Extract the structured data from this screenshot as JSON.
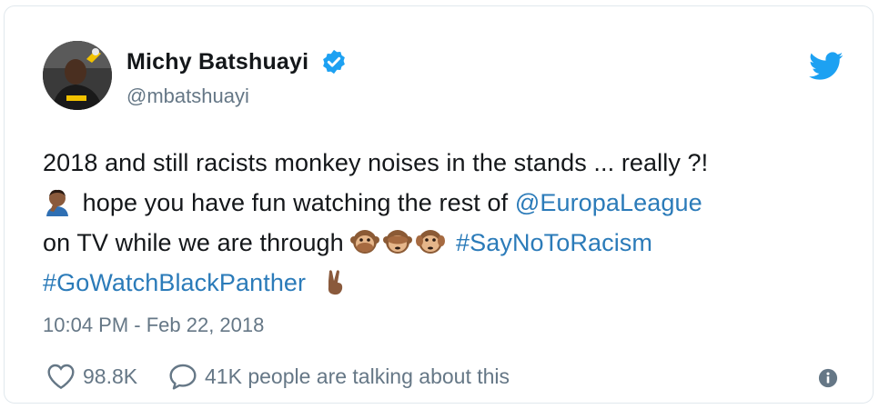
{
  "tweet": {
    "author": {
      "display_name": "Michy Batshuayi",
      "handle": "@mbatshuayi",
      "verified": true
    },
    "text": {
      "line1": "2018 and still racists monkey noises in the stands ... really ?!",
      "line2_text": "hope you have fun watching the rest of",
      "mention": "@EuropaLeague",
      "line3_text": "on TV while we are through",
      "hashtag1": "#SayNoToRacism",
      "hashtag2": "#GoWatchBlackPanther"
    },
    "timestamp": "10:04 PM - Feb 22, 2018",
    "likes": "98.8K",
    "talking": "41K people are talking about this"
  },
  "colors": {
    "link": "#2b7bb9",
    "twitter_blue": "#1da1f2",
    "muted": "#657786",
    "text": "#14171a"
  },
  "icons": {
    "verified": "verified-badge-icon",
    "twitter": "twitter-bird-icon",
    "like": "heart-icon",
    "reply": "speech-bubble-icon",
    "info": "info-icon",
    "emoji_facepalm": "man-facepalming-emoji",
    "emoji_monkeys": [
      "speak-no-evil-monkey-emoji",
      "see-no-evil-monkey-emoji",
      "hear-no-evil-monkey-emoji"
    ],
    "emoji_victory": "victory-hand-emoji"
  }
}
